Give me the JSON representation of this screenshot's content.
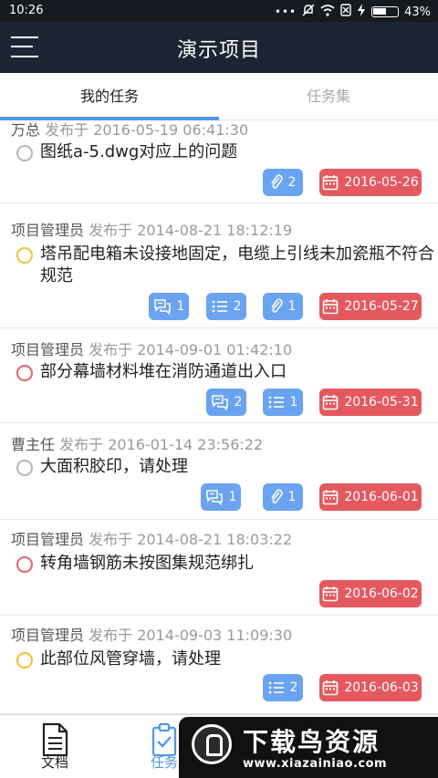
{
  "status_bar": {
    "time": "10:26",
    "dots": "•••",
    "battery": "43%"
  },
  "header": {
    "title": "演示项目"
  },
  "tabs": [
    {
      "label": "我的任务",
      "active": true
    },
    {
      "label": "任务集",
      "active": false
    }
  ],
  "tasks": [
    {
      "author": "万总",
      "meta": "发布于 2016-05-19 06:41:30",
      "title": "图纸a-5.dwg对应上的问题",
      "status": "gray",
      "comments": null,
      "lists": null,
      "attachments": "2",
      "due": "2016-05-26"
    },
    {
      "author": "项目管理员",
      "meta": "发布于 2014-08-21 18:12:19",
      "title": "塔吊配电箱未设接地固定，电缆上引线未加瓷瓶不符合规范",
      "status": "yellow",
      "comments": "1",
      "lists": "2",
      "attachments": "1",
      "due": "2016-05-27"
    },
    {
      "author": "项目管理员",
      "meta": "发布于 2014-09-01 01:42:10",
      "title": "部分幕墙材料堆在消防通道出入口",
      "status": "red",
      "comments": "2",
      "lists": "1",
      "attachments": null,
      "due": "2016-05-31"
    },
    {
      "author": "曹主任",
      "meta": "发布于 2016-01-14 23:56:22",
      "title": "大面积胶印，请处理",
      "status": "gray",
      "comments": "1",
      "lists": null,
      "attachments": "1",
      "due": "2016-06-01"
    },
    {
      "author": "项目管理员",
      "meta": "发布于 2014-08-21 18:03:22",
      "title": "转角墙钢筋未按图集规范绑扎",
      "status": "red",
      "comments": null,
      "lists": null,
      "attachments": null,
      "due": "2016-06-02"
    },
    {
      "author": "项目管理员",
      "meta": "发布于 2014-09-03 11:09:30",
      "title": "此部位风管穿墙，请处理",
      "status": "yellow",
      "comments": null,
      "lists": "2",
      "attachments": null,
      "due": "2016-06-03"
    }
  ],
  "bottom_nav": [
    {
      "label": "文档",
      "icon": "document-icon",
      "active": false
    },
    {
      "label": "任务",
      "icon": "task-icon",
      "active": true
    }
  ],
  "watermark": {
    "text": "下载鸟资源",
    "url": "www.xiazainiao.com"
  },
  "colors": {
    "accent": "#4f97e9",
    "badge_blue": "#6aa3ef",
    "badge_red": "#e3595f",
    "header_bg": "#1b2533"
  }
}
